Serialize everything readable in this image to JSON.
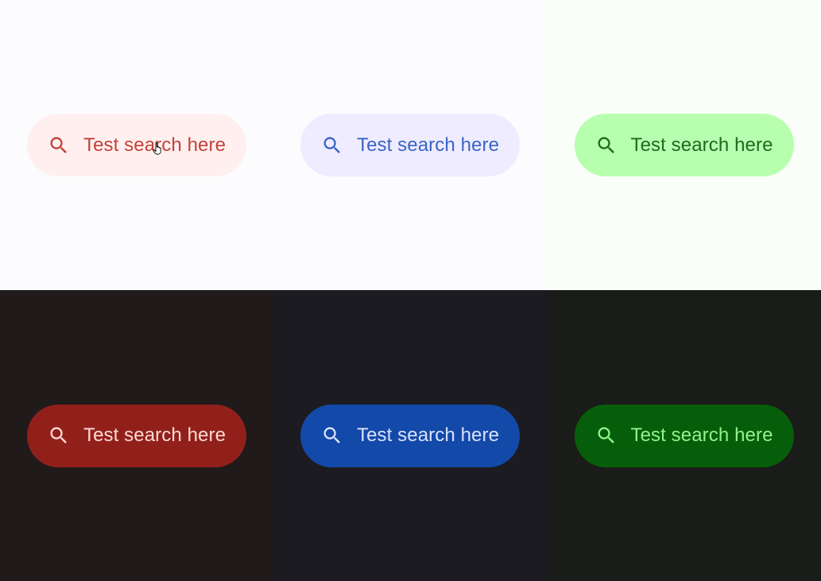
{
  "search_bars": [
    {
      "id": "red-light",
      "text": "Test search here",
      "icon": "search-icon",
      "background": "#fff0ef",
      "color": "#c2423a"
    },
    {
      "id": "blue-light",
      "text": "Test search here",
      "icon": "search-icon",
      "background": "#eeecfe",
      "color": "#3b64c8"
    },
    {
      "id": "green-light",
      "text": "Test search here",
      "icon": "search-icon",
      "background": "#b7ffaf",
      "color": "#1c6b1f"
    },
    {
      "id": "red-dark",
      "text": "Test search here",
      "icon": "search-icon",
      "background": "#92201a",
      "color": "#ffd9d5"
    },
    {
      "id": "blue-dark",
      "text": "Test search here",
      "icon": "search-icon",
      "background": "#1349a8",
      "color": "#d9e2ff"
    },
    {
      "id": "green-dark",
      "text": "Test search here",
      "icon": "search-icon",
      "background": "#075e0a",
      "color": "#8ef58a"
    }
  ],
  "panels": {
    "red_light": "#fcfcfe",
    "blue_light": "#fcfcfe",
    "green_light": "#f9fff8",
    "red_dark": "#201a1a",
    "blue_dark": "#1c1b21",
    "green_dark": "#1a1c19"
  },
  "cursor": {
    "icon": "hand-pointer-icon"
  }
}
